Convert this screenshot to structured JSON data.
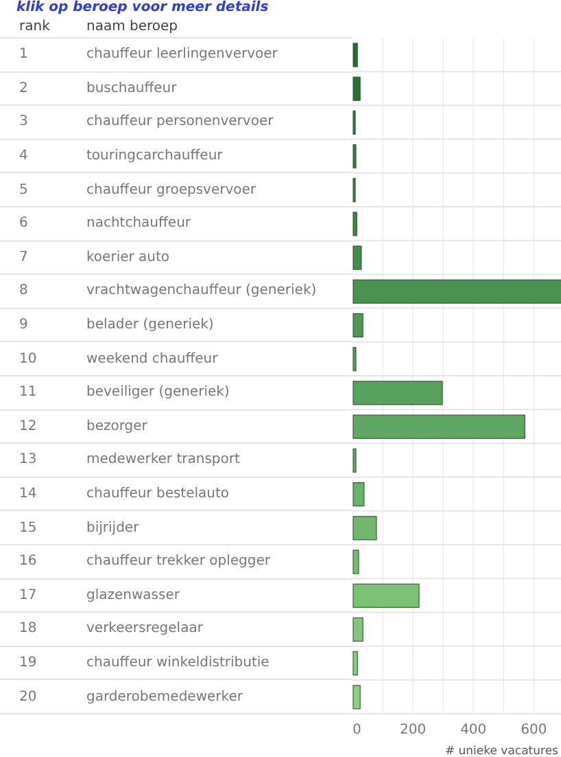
{
  "title": "klik op beroep voor meer details",
  "table": {
    "columns": [
      "rank",
      "naam beroep"
    ],
    "rows": [
      {
        "rank": "1",
        "name": "chauffeur leerlingenvervoer"
      },
      {
        "rank": "2",
        "name": "buschauffeur"
      },
      {
        "rank": "3",
        "name": "chauffeur personenvervoer"
      },
      {
        "rank": "4",
        "name": "touringcarchauffeur"
      },
      {
        "rank": "5",
        "name": "chauffeur groepsvervoer"
      },
      {
        "rank": "6",
        "name": "nachtchauffeur"
      },
      {
        "rank": "7",
        "name": "koerier auto"
      },
      {
        "rank": "8",
        "name": "vrachtwagenchauffeur (generiek)"
      },
      {
        "rank": "9",
        "name": "belader (generiek)"
      },
      {
        "rank": "10",
        "name": "weekend chauffeur"
      },
      {
        "rank": "11",
        "name": "beveiliger (generiek)"
      },
      {
        "rank": "12",
        "name": "bezorger"
      },
      {
        "rank": "13",
        "name": "medewerker transport"
      },
      {
        "rank": "14",
        "name": "chauffeur bestelauto"
      },
      {
        "rank": "15",
        "name": "bijrijder"
      },
      {
        "rank": "16",
        "name": "chauffeur trekker oplegger"
      },
      {
        "rank": "17",
        "name": "glazenwasser"
      },
      {
        "rank": "18",
        "name": "verkeersregelaar"
      },
      {
        "rank": "19",
        "name": "chauffeur winkeldistributie"
      },
      {
        "rank": "20",
        "name": "garderobemedewerker"
      }
    ]
  },
  "chart_data": {
    "type": "bar",
    "orientation": "horizontal",
    "xlabel": "# unieke vacatures",
    "values": [
      14,
      23,
      4,
      9,
      5,
      12,
      27,
      690,
      32,
      9,
      295,
      568,
      9,
      36,
      77,
      18,
      218,
      32,
      14,
      23
    ],
    "xlim": [
      0,
      690
    ],
    "xticks": [
      0,
      200,
      400,
      600
    ],
    "grid": true
  }
}
